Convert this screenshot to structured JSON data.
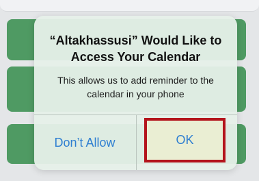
{
  "dialog": {
    "title_line1": "“Altakhassusi” Would Like to",
    "title_line2": "Access Your Calendar",
    "message_line1": "This allows us to add reminder to the",
    "message_line2": "calendar in your phone",
    "deny_label": "Don’t Allow",
    "ok_label": "OK"
  },
  "colors": {
    "card_green": "#4f9a63",
    "highlight_border": "#b4141c",
    "button_text": "#2f7fd1"
  }
}
